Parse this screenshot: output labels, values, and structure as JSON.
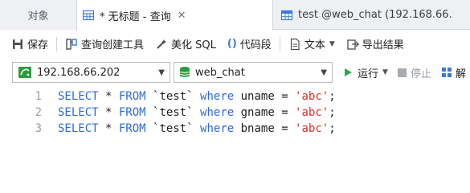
{
  "tabs": [
    {
      "label": "对象",
      "active": false
    },
    {
      "label": "* 无标题 - 查询",
      "active": true
    },
    {
      "label": "test @web_chat (192.168.66.",
      "active": false
    }
  ],
  "toolbar": {
    "save": "保存",
    "query_builder": "查询创建工具",
    "beautify": "美化 SQL",
    "snippet": "代码段",
    "text": "文本",
    "export": "导出结果"
  },
  "connection": {
    "host": "192.168.66.202",
    "database": "web_chat"
  },
  "controls": {
    "run": "运行",
    "stop": "停止",
    "explain": "解"
  },
  "editor": {
    "lines": [
      {
        "num": "1",
        "kw1": "SELECT",
        "star": " * ",
        "kw2": "FROM",
        "table": " `test` ",
        "kw3": "where",
        "col": " uname = ",
        "str": "'abc'",
        "end": ";"
      },
      {
        "num": "2",
        "kw1": "SELECT",
        "star": " * ",
        "kw2": "FROM",
        "table": " `test` ",
        "kw3": "where",
        "col": " gname = ",
        "str": "'abc'",
        "end": ";"
      },
      {
        "num": "3",
        "kw1": "SELECT",
        "star": " * ",
        "kw2": "FROM",
        "table": " `test` ",
        "kw3": "where",
        "col": " bname = ",
        "str": "'abc'",
        "end": ";"
      }
    ]
  },
  "colors": {
    "keyword": "#2e6bd6",
    "string": "#d93025",
    "run_green": "#2da84a",
    "db_green": "#2a9d3c"
  }
}
